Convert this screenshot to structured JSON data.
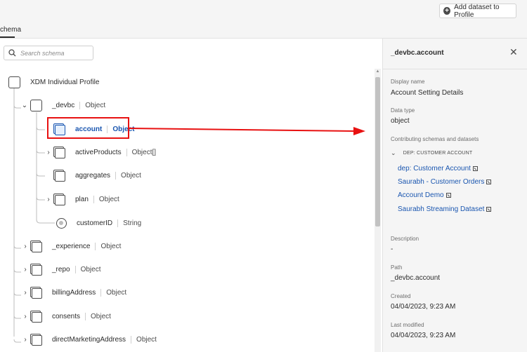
{
  "header": {
    "add_dataset_label": "Add dataset to Profile",
    "tab_label": "chema"
  },
  "search": {
    "placeholder": "Search schema"
  },
  "tree": {
    "root": {
      "label": "XDM Individual Profile"
    },
    "devbc": {
      "label": "_devbc",
      "type": "Object"
    },
    "children": [
      {
        "label": "account",
        "type": "Object"
      },
      {
        "label": "activeProducts",
        "type": "Object[]"
      },
      {
        "label": "aggregates",
        "type": "Object"
      },
      {
        "label": "plan",
        "type": "Object"
      },
      {
        "label": "customerID",
        "type": "String"
      }
    ],
    "siblings": [
      {
        "label": "_experience",
        "type": "Object"
      },
      {
        "label": "_repo",
        "type": "Object"
      },
      {
        "label": "billingAddress",
        "type": "Object"
      },
      {
        "label": "consents",
        "type": "Object"
      },
      {
        "label": "directMarketingAddress",
        "type": "Object"
      }
    ]
  },
  "details": {
    "title": "_devbc.account",
    "display_name_key": "Display name",
    "display_name": "Account Setting Details",
    "data_type_key": "Data type",
    "data_type": "object",
    "contributing_key": "Contributing schemas and datasets",
    "group_label": "DEP: CUSTOMER ACCOUNT",
    "links": [
      "dep: Customer Account",
      "Saurabh - Customer Orders",
      "Account Demo",
      "Saurabh Streaming Dataset"
    ],
    "description_key": "Description",
    "description": "-",
    "path_key": "Path",
    "path": "_devbc.account",
    "created_key": "Created",
    "created": "04/04/2023, 9:23 AM",
    "modified_key": "Last modified",
    "modified": "04/04/2023, 9:23 AM"
  },
  "colors": {
    "link": "#1a56b0",
    "annotation": "#e81111"
  },
  "icons": [
    "plus-circle-icon",
    "search-icon",
    "close-icon",
    "chevron-right-icon",
    "chevron-down-icon",
    "object-icon",
    "field-icon",
    "external-link-icon"
  ]
}
